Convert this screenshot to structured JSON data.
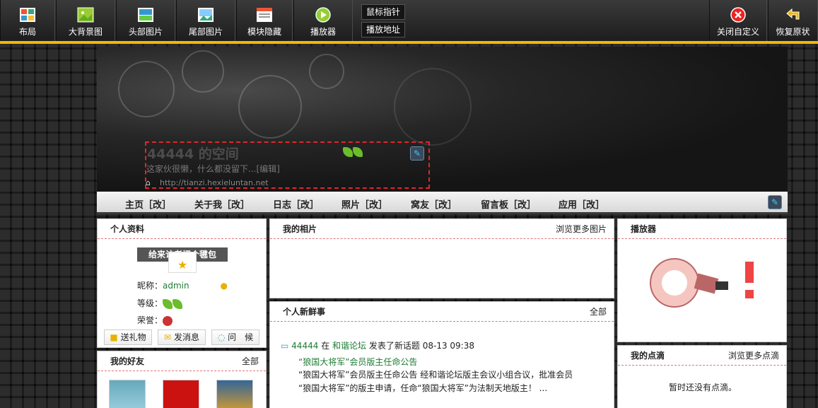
{
  "toolbar": {
    "layout": "布局",
    "bg_image": "大背景图",
    "header_image": "头部图片",
    "footer_image": "尾部图片",
    "module_hide": "模块隐藏",
    "player": "播放器",
    "mouse_pointer": "鼠标指针",
    "play_url": "播放地址",
    "close_custom": "关闭自定义",
    "restore": "恢复原状"
  },
  "header": {
    "title": "44444 的空间",
    "subtitle": "这家伙很懒，什么都没留下...[编辑]",
    "url": "http://tianzi.hexieluntan.net"
  },
  "nav": [
    "主页［改］",
    "关于我［改］",
    "日志［改］",
    "照片［改］",
    "窝友［改］",
    "留言板［改］",
    "应用［改］"
  ],
  "profile": {
    "title": "个人资料",
    "banner_text": "给来访者埋个毽包",
    "nickname_label": "昵称：",
    "nickname": "admin",
    "level_label": "等级：",
    "honor_label": "荣誉：",
    "buttons": [
      "送礼物",
      "发消息",
      "问　候"
    ]
  },
  "friends": {
    "title": "我的好友",
    "more": "全部"
  },
  "photos": {
    "title": "我的相片",
    "more": "浏览更多图片"
  },
  "news": {
    "title": "个人新鲜事",
    "more": "全部",
    "user": "44444",
    "in": "在",
    "forum": "和谐论坛",
    "action": "发表了新话题",
    "time": "08-13 09:38",
    "topic": "“狼国大将军”会员版主任命公告",
    "line1": "“狼国大将军”会员版主任命公告 经和谐论坛版主会议小组合议，批准会员",
    "line2": "“狼国大将军”的版主申请，任命“狼国大将军”为法制天地版主！ ..."
  },
  "player": {
    "title": "播放器"
  },
  "dots": {
    "title": "我的点滴",
    "more": "浏览更多点滴",
    "empty": "暂时还没有点滴。"
  },
  "colors": {
    "accent": "#f2b705",
    "dashed": "#e0262b",
    "link": "#1e7b34"
  }
}
